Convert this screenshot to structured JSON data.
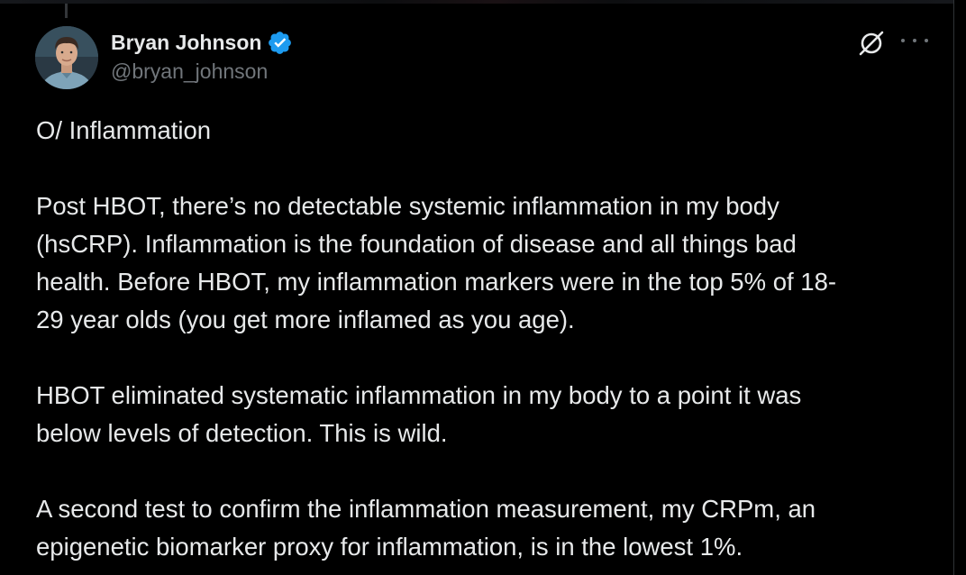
{
  "author": {
    "display_name": "Bryan Johnson",
    "handle": "@bryan_johnson",
    "verified": true,
    "verified_color": "#1d9bf0"
  },
  "icons": {
    "avatar": "profile-photo",
    "badge": "verified-badge-icon",
    "grok": "grok-icon",
    "more": "more-options-icon"
  },
  "tweet": {
    "paragraphs": [
      [
        "O/ Inflammation"
      ],
      [
        "Post HBOT, there’s no detectable systemic inflammation in my body",
        "(hsCRP). Inflammation is the foundation of disease and all things bad",
        "health.  Before HBOT, my inflammation markers were in the top 5% of 18-",
        "29 year olds (you get more inflamed as you age)."
      ],
      [
        "HBOT eliminated systematic inflammation in my body to a point it was",
        "below levels of detection. This is wild."
      ],
      [
        "A second test to confirm the inflammation measurement, my CRPm, an",
        "epigenetic biomarker proxy for inflammation, is in the lowest 1%."
      ]
    ]
  },
  "colors": {
    "background": "#000000",
    "text_primary": "#e7e9ea",
    "text_secondary": "#71767b",
    "accent": "#1d9bf0"
  }
}
